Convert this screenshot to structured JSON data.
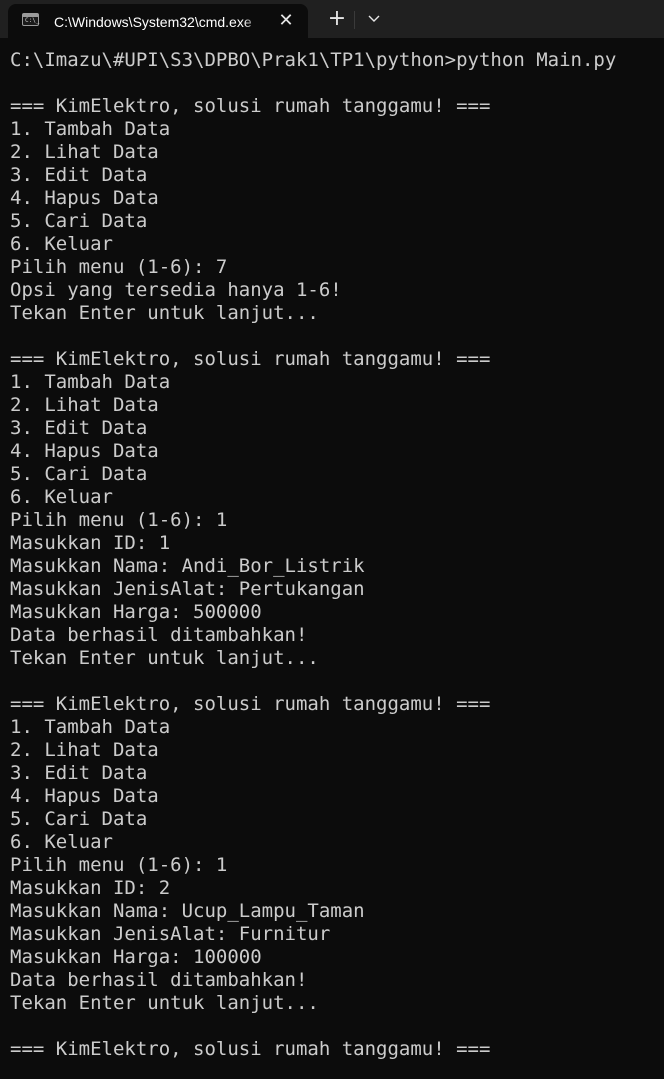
{
  "window": {
    "tab_title": "C:\\Windows\\System32\\cmd.exe",
    "tab_icon_glyph": "C:\\_",
    "close_glyph": "✕",
    "new_tab_glyph": "+",
    "dropdown_icon": "chevron-down-icon",
    "colors": {
      "background": "#0c0c0c",
      "titlebar": "#202020",
      "text": "#cccccc"
    }
  },
  "terminal": {
    "lines": [
      "C:\\Imazu\\#UPI\\S3\\DPBO\\Prak1\\TP1\\python>python Main.py",
      "",
      "=== KimElektro, solusi rumah tanggamu! ===",
      "1. Tambah Data",
      "2. Lihat Data",
      "3. Edit Data",
      "4. Hapus Data",
      "5. Cari Data",
      "6. Keluar",
      "Pilih menu (1-6): 7",
      "Opsi yang tersedia hanya 1-6!",
      "Tekan Enter untuk lanjut...",
      "",
      "=== KimElektro, solusi rumah tanggamu! ===",
      "1. Tambah Data",
      "2. Lihat Data",
      "3. Edit Data",
      "4. Hapus Data",
      "5. Cari Data",
      "6. Keluar",
      "Pilih menu (1-6): 1",
      "Masukkan ID: 1",
      "Masukkan Nama: Andi_Bor_Listrik",
      "Masukkan JenisAlat: Pertukangan",
      "Masukkan Harga: 500000",
      "Data berhasil ditambahkan!",
      "Tekan Enter untuk lanjut...",
      "",
      "=== KimElektro, solusi rumah tanggamu! ===",
      "1. Tambah Data",
      "2. Lihat Data",
      "3. Edit Data",
      "4. Hapus Data",
      "5. Cari Data",
      "6. Keluar",
      "Pilih menu (1-6): 1",
      "Masukkan ID: 2",
      "Masukkan Nama: Ucup_Lampu_Taman",
      "Masukkan JenisAlat: Furnitur",
      "Masukkan Harga: 100000",
      "Data berhasil ditambahkan!",
      "Tekan Enter untuk lanjut...",
      "",
      "=== KimElektro, solusi rumah tanggamu! ==="
    ]
  }
}
